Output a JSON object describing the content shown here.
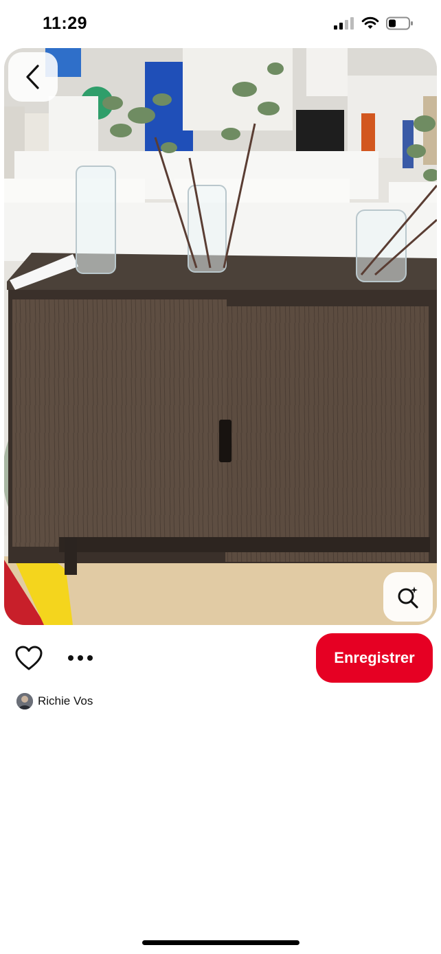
{
  "status_bar": {
    "time": "11:29",
    "battery_level": 0.3
  },
  "pin": {
    "image_alt": "Dark brown wooden two-door cabinet with glass vases on top in a furniture store",
    "author_name": "Richie Vos",
    "save_label": "Enregistrer"
  },
  "icons": {
    "back": "chevron-left-icon",
    "visual_search": "visual-search-icon",
    "like": "heart-icon",
    "more": "more-icon"
  },
  "colors": {
    "save_button": "#e60023",
    "background": "#ffffff"
  }
}
